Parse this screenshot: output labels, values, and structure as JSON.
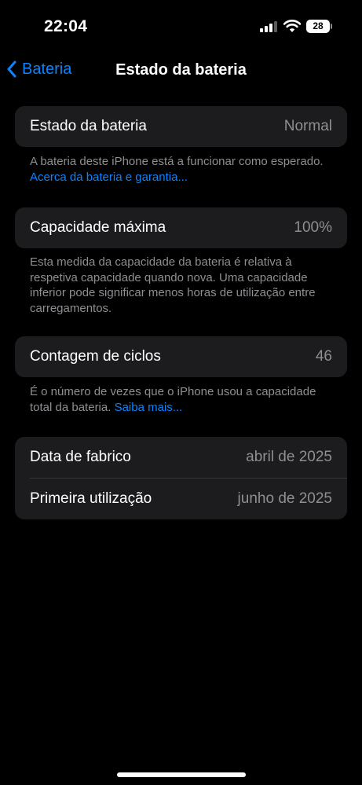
{
  "status_bar": {
    "time": "22:04",
    "battery_level": "28",
    "signal_icon": "cellular-signal-icon",
    "wifi_icon": "wifi-icon"
  },
  "nav": {
    "back_label": "Bateria",
    "title": "Estado da bateria"
  },
  "battery_health": {
    "label": "Estado da bateria",
    "value": "Normal",
    "footnote_text": "A bateria deste iPhone está a funcionar como esperado.",
    "footnote_link": "Acerca da bateria e garantia..."
  },
  "max_capacity": {
    "label": "Capacidade máxima",
    "value": "100%",
    "footnote_text": "Esta medida da capacidade da bateria é relativa à respetiva capacidade quando nova. Uma capacidade inferior pode significar menos horas de utilização entre carregamentos."
  },
  "cycle_count": {
    "label": "Contagem de ciclos",
    "value": "46",
    "footnote_text": "É o número de vezes que o iPhone usou a capacidade total da bateria.",
    "footnote_link": "Saiba mais..."
  },
  "dates": {
    "manufacture_label": "Data de fabrico",
    "manufacture_value": "abril de 2025",
    "first_use_label": "Primeira utilização",
    "first_use_value": "junho de 2025"
  },
  "colors": {
    "background": "#000000",
    "cell": "#1c1c1e",
    "accent": "#0a84ff",
    "secondary_text": "#8e8e93"
  }
}
